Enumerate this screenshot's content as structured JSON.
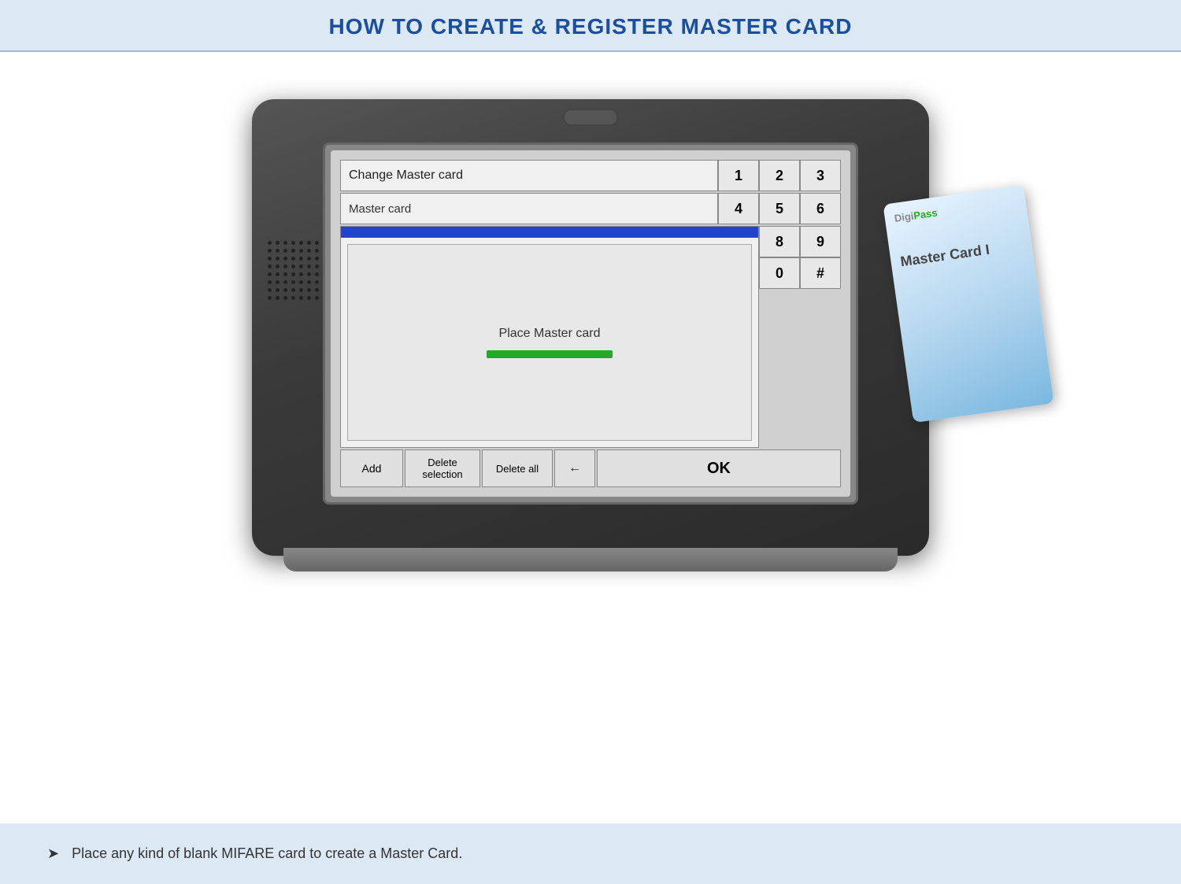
{
  "header": {
    "title": "HOW TO CREATE & REGISTER MASTER CARD"
  },
  "screen": {
    "title_field": "Change Master card",
    "input_field": "Master card",
    "place_card_text": "Place Master card",
    "buttons": {
      "add": "Add",
      "delete_selection": "Delete\nselection",
      "delete_all": "Delete all",
      "backspace": "←",
      "ok": "OK"
    },
    "numpad": [
      "1",
      "2",
      "3",
      "4",
      "5",
      "6",
      "8",
      "9",
      "0",
      "#"
    ]
  },
  "digipass": {
    "logo_digi": "Digi",
    "logo_pass": "Pass",
    "card_text": "Master Card  I"
  },
  "bottom": {
    "arrow": "➤",
    "text": "Place any kind of blank MIFARE card to create a Master Card."
  }
}
